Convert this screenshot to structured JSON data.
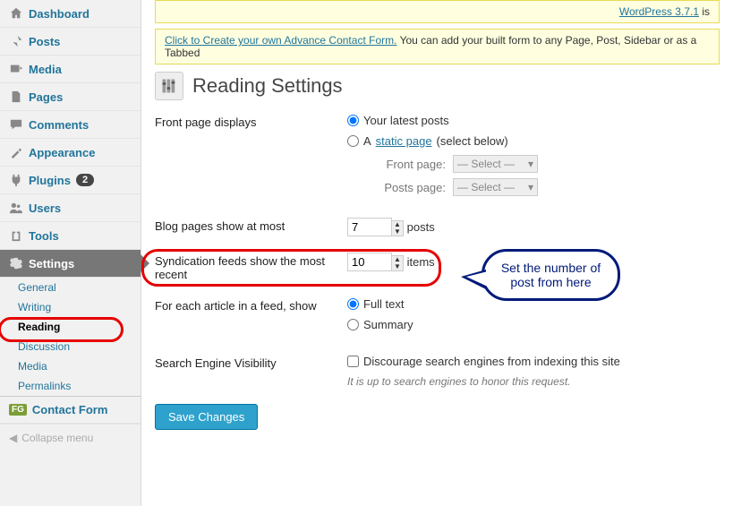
{
  "sidebar": {
    "items": [
      {
        "label": "Dashboard",
        "icon": "home"
      },
      {
        "label": "Posts",
        "icon": "pin"
      },
      {
        "label": "Media",
        "icon": "media"
      },
      {
        "label": "Pages",
        "icon": "page"
      },
      {
        "label": "Comments",
        "icon": "comment"
      },
      {
        "label": "Appearance",
        "icon": "appearance"
      },
      {
        "label": "Plugins",
        "icon": "plugin",
        "badge": "2"
      },
      {
        "label": "Users",
        "icon": "users"
      },
      {
        "label": "Tools",
        "icon": "tools"
      },
      {
        "label": "Settings",
        "icon": "settings",
        "current": true
      },
      {
        "label": "Contact Form",
        "icon": "contact",
        "fg": true
      }
    ],
    "subs": [
      "General",
      "Writing",
      "Reading",
      "Discussion",
      "Media",
      "Permalinks"
    ],
    "active_sub": "Reading",
    "collapse": "Collapse menu"
  },
  "notices": {
    "version_link": "WordPress 3.7.1",
    "version_suffix": " is",
    "contact_link": "Click to Create your own Advance Contact Form.",
    "contact_text": " You can add your built form to any Page, Post, Sidebar or as a Tabbed"
  },
  "page_title": "Reading Settings",
  "frontpage": {
    "label": "Front page displays",
    "opt1": "Your latest posts",
    "opt2_pre": "A ",
    "opt2_link": "static page",
    "opt2_post": " (select below)",
    "front_label": "Front page:",
    "posts_label": "Posts page:",
    "select_placeholder": "— Select —"
  },
  "blogpages": {
    "label": "Blog pages show at most",
    "value": "7",
    "unit": "posts"
  },
  "syndication": {
    "label": "Syndication feeds show the most recent",
    "value": "10",
    "unit": "items"
  },
  "feedshow": {
    "label": "For each article in a feed, show",
    "opt1": "Full text",
    "opt2": "Summary"
  },
  "searchengine": {
    "label": "Search Engine Visibility",
    "checkbox": "Discourage search engines from indexing this site",
    "desc": "It is up to search engines to honor this request."
  },
  "save_btn": "Save Changes",
  "callout": "Set the number of post from here"
}
